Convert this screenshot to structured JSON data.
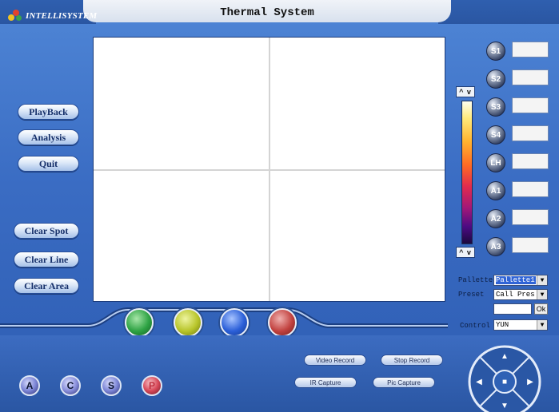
{
  "app": {
    "title": "Thermal System",
    "logo_text": "INTELLISYSTEM"
  },
  "left_menu": {
    "playback": "PlayBack",
    "analysis": "Analysis",
    "quit": "Quit",
    "clear_spot": "Clear Spot",
    "clear_line": "Clear Line",
    "clear_area": "Clear Area"
  },
  "measure_buttons": [
    {
      "label": "S1"
    },
    {
      "label": "S2"
    },
    {
      "label": "S3"
    },
    {
      "label": "S4"
    },
    {
      "label": "LH"
    },
    {
      "label": "A1"
    },
    {
      "label": "A2"
    },
    {
      "label": "A3"
    }
  ],
  "scale": {
    "up_down_top": "^ v",
    "up_down_bottom": "^ v"
  },
  "controls": {
    "pallette_label": "Pallette",
    "pallette_value": "Pallette1",
    "preset_label": "Preset",
    "preset_value": "Call Pres",
    "ok_label": "Ok",
    "control_label": "Control",
    "control_value": "YUN"
  },
  "orbs": {
    "colors": [
      "#2ea344",
      "#b8c52a",
      "#2b5fd8",
      "#c2423f"
    ]
  },
  "record": {
    "video_record": "Video Record",
    "stop_record": "Stop Record",
    "ir_capture": "IR Capture",
    "pic_capture": "Pic Capture"
  },
  "modes": [
    {
      "label": "A",
      "color": "#7d86d6"
    },
    {
      "label": "C",
      "color": "#8a90dc"
    },
    {
      "label": "S",
      "color": "#7f88d8"
    },
    {
      "label": "P",
      "color": "#d94a5a"
    }
  ]
}
